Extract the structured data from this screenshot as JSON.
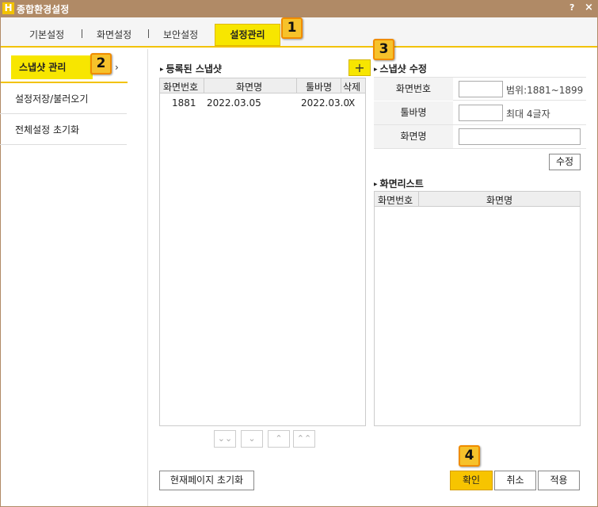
{
  "window": {
    "title": "종합환경설정",
    "logo_letter": "H",
    "help_label": "?",
    "close_label": "×"
  },
  "tabs": [
    "기본설정",
    "화면설정",
    "보안설정",
    "설정관리"
  ],
  "sidebar": {
    "items": [
      "스냅샷 관리",
      "설정저장/불러오기",
      "전체설정 초기화"
    ],
    "active_arrow": "›"
  },
  "registered": {
    "title": "등록된 스냅샷",
    "add_label": "+",
    "columns": [
      "화면번호",
      "화면명",
      "툴바명",
      "삭제"
    ],
    "rows": [
      {
        "screen_no": "1881",
        "screen_name": "2022.03.05",
        "toolbar_name": "2022.03.0",
        "delete": "X"
      }
    ],
    "nav_buttons": [
      "⌄⌄",
      "⌄",
      "⌃",
      "⌃⌃"
    ]
  },
  "edit": {
    "title": "스냅샷 수정",
    "fields": [
      {
        "label": "화면번호",
        "value": "",
        "hint": "범위:1881~1899"
      },
      {
        "label": "툴바명",
        "value": "",
        "hint": "최대 4글자"
      },
      {
        "label": "화면명",
        "value": "",
        "hint": ""
      }
    ],
    "modify_label": "수정"
  },
  "screen_list": {
    "title": "화면리스트",
    "columns": [
      "화면번호",
      "화면명"
    ]
  },
  "footer": {
    "reset_page_label": "현재페이지 초기화",
    "ok_label": "확인",
    "cancel_label": "취소",
    "apply_label": "적용"
  },
  "annotations": [
    "1",
    "2",
    "3",
    "4"
  ],
  "colors": {
    "titlebar": "#b08a66",
    "highlight_yellow": "#f7e600",
    "badge_fill": "#f6c22b",
    "badge_border": "#f08c00",
    "primary_button": "#f7c400"
  }
}
